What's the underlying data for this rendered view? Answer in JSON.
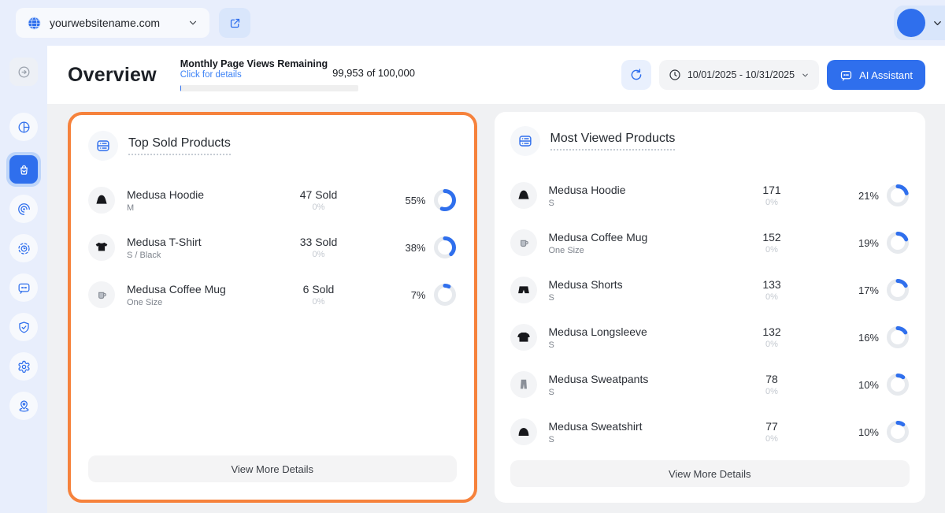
{
  "topbar": {
    "site": "yourwebsitename.com",
    "site_icon": "globe-icon",
    "open_site_icon": "external-link-icon",
    "account_icon": "chevron-down-icon"
  },
  "sidebar": {
    "items": [
      {
        "name": "sidebar-toggle",
        "icon": "collapse-icon",
        "active": false,
        "style": "square"
      },
      {
        "name": "sidebar-item-analytics",
        "icon": "pie-chart-icon",
        "active": false,
        "style": ""
      },
      {
        "name": "sidebar-item-store",
        "icon": "shopping-bag-icon",
        "active": true,
        "style": ""
      },
      {
        "name": "sidebar-item-sessions",
        "icon": "spiral-icon",
        "active": false,
        "style": ""
      },
      {
        "name": "sidebar-item-heatmap",
        "icon": "target-clock-icon",
        "active": false,
        "style": ""
      },
      {
        "name": "sidebar-item-chat",
        "icon": "chat-bubble-icon",
        "active": false,
        "style": ""
      },
      {
        "name": "sidebar-item-security",
        "icon": "shield-check-icon",
        "active": false,
        "style": ""
      },
      {
        "name": "sidebar-item-settings",
        "icon": "gear-icon",
        "active": false,
        "style": ""
      },
      {
        "name": "sidebar-item-geography",
        "icon": "map-pin-icon",
        "active": false,
        "style": ""
      }
    ]
  },
  "header": {
    "title": "Overview",
    "page_views": {
      "label": "Monthly Page Views Remaining",
      "link": "Click for details",
      "usage": "99,953 of 100,000",
      "percent_used": 0.05
    },
    "refresh_icon": "refresh-icon",
    "date_range": "10/01/2025 - 10/31/2025",
    "date_icon": "clock-icon",
    "ai_assistant": {
      "label": "AI Assistant",
      "icon": "chat-bubble-icon"
    }
  },
  "cards": [
    {
      "title": "Top Sold Products",
      "icon": "list-server-icon",
      "highlighted": true,
      "footer": "View More Details",
      "rows": [
        {
          "product": "Medusa Hoodie",
          "variant": "M",
          "count": "47 Sold",
          "sub": "0%",
          "percent": 55,
          "percent_label": "55%",
          "image": "hoodie"
        },
        {
          "product": "Medusa T-Shirt",
          "variant": "S / Black",
          "count": "33 Sold",
          "sub": "0%",
          "percent": 38,
          "percent_label": "38%",
          "image": "tshirt"
        },
        {
          "product": "Medusa Coffee Mug",
          "variant": "One Size",
          "count": "6 Sold",
          "sub": "0%",
          "percent": 7,
          "percent_label": "7%",
          "image": "mug"
        }
      ]
    },
    {
      "title": "Most Viewed Products",
      "icon": "list-server-icon",
      "highlighted": false,
      "footer": "View More Details",
      "rows": [
        {
          "product": "Medusa Hoodie",
          "variant": "S",
          "count": "171",
          "sub": "0%",
          "percent": 21,
          "percent_label": "21%",
          "image": "hoodie"
        },
        {
          "product": "Medusa Coffee Mug",
          "variant": "One Size",
          "count": "152",
          "sub": "0%",
          "percent": 19,
          "percent_label": "19%",
          "image": "mug"
        },
        {
          "product": "Medusa Shorts",
          "variant": "S",
          "count": "133",
          "sub": "0%",
          "percent": 17,
          "percent_label": "17%",
          "image": "shorts"
        },
        {
          "product": "Medusa Longsleeve",
          "variant": "S",
          "count": "132",
          "sub": "0%",
          "percent": 16,
          "percent_label": "16%",
          "image": "longsleeve"
        },
        {
          "product": "Medusa Sweatpants",
          "variant": "S",
          "count": "78",
          "sub": "0%",
          "percent": 10,
          "percent_label": "10%",
          "image": "sweatpants"
        },
        {
          "product": "Medusa Sweatshirt",
          "variant": "S",
          "count": "77",
          "sub": "0%",
          "percent": 10,
          "percent_label": "10%",
          "image": "sweatshirt"
        }
      ]
    }
  ],
  "colors": {
    "accent": "#2f6fed",
    "highlight_border": "#f6823c",
    "donut_track": "#e7eaee",
    "topbar_bg": "#e8eefc",
    "content_bg": "#f0f1f3"
  }
}
